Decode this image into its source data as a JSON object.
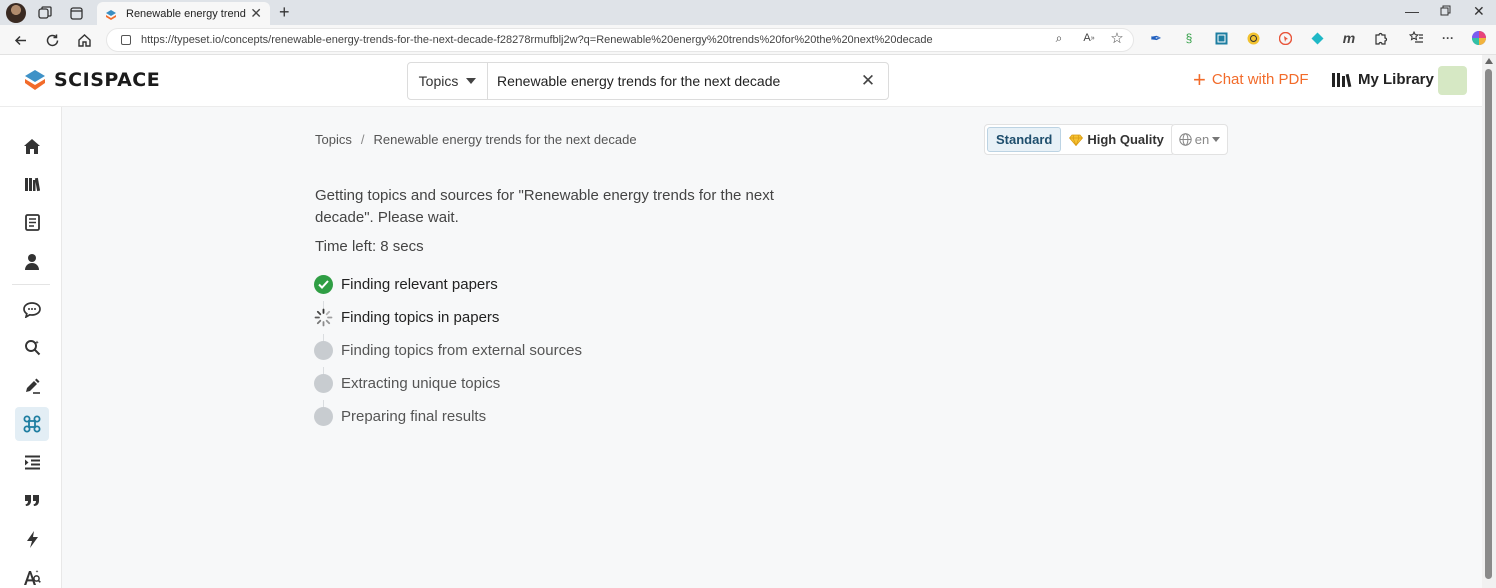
{
  "browser": {
    "tab_title": "Renewable energy trends for the next decade",
    "url": "https://typeset.io/concepts/renewable-energy-trends-for-the-next-decade-f28278rmufblj2w?q=Renewable%20energy%20trends%20for%20the%20next%20decade"
  },
  "header": {
    "logo_text": "SCISPACE",
    "search_type": "Topics",
    "search_value": "Renewable energy trends for the next decade",
    "chat_pdf_label": "Chat with PDF",
    "my_library_label": "My Library"
  },
  "sidebar": {
    "items": [
      {
        "name": "home-icon"
      },
      {
        "name": "library-icon"
      },
      {
        "name": "notebook-icon"
      },
      {
        "name": "profile-icon"
      },
      {
        "name": "chat-icon"
      },
      {
        "name": "literature-search-icon"
      },
      {
        "name": "pen-icon"
      },
      {
        "name": "topics-icon",
        "active": true
      },
      {
        "name": "paraphraser-icon"
      },
      {
        "name": "citation-icon"
      },
      {
        "name": "lightning-icon"
      },
      {
        "name": "ai-detector-icon"
      }
    ]
  },
  "main": {
    "breadcrumb_root": "Topics",
    "breadcrumb_sep": "/",
    "breadcrumb_current": "Renewable energy trends for the next decade",
    "quality_standard": "Standard",
    "quality_high": "High Quality",
    "language": "en",
    "status_message": "Getting topics and sources for \"Renewable energy trends for the next decade\". Please wait.",
    "time_left": "Time left: 8 secs",
    "steps": [
      {
        "label": "Finding relevant papers",
        "state": "done"
      },
      {
        "label": "Finding topics in papers",
        "state": "active"
      },
      {
        "label": "Finding topics from external sources",
        "state": "pending"
      },
      {
        "label": "Extracting unique topics",
        "state": "pending"
      },
      {
        "label": "Preparing final results",
        "state": "pending"
      }
    ]
  },
  "colors": {
    "accent_orange": "#f26b2a",
    "done_green": "#2f9e44",
    "pending_gray": "#c8ccd0",
    "active_sidebar_bg": "#e3eef5",
    "icon_teal": "#1e7ea1"
  }
}
